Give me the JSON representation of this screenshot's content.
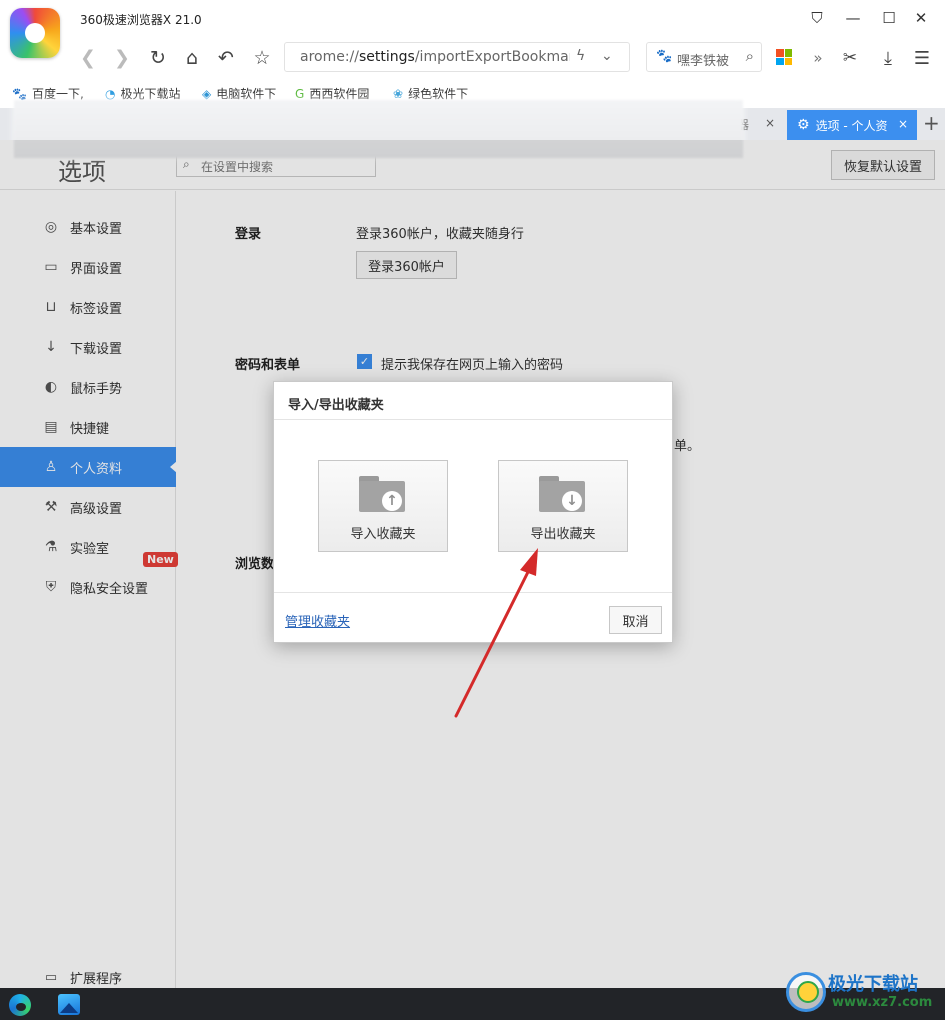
{
  "app": {
    "title": "360极速浏览器X 21.0",
    "icons": [
      "app-logo",
      "pin-icon",
      "minimize-icon",
      "maximize-icon",
      "close-icon"
    ]
  },
  "toolbar": {
    "url_prefix": "arome://",
    "url_host": "settings",
    "url_path": "/importExportBookmark",
    "search_text": "嘿李铁被",
    "icons": [
      "back-icon",
      "forward-icon",
      "reload-icon",
      "home-icon",
      "undo-icon",
      "star-icon",
      "bolt-icon",
      "chevron-down-icon",
      "paw-icon",
      "search-icon",
      "apps-icon",
      "more-icon",
      "scissors-icon",
      "download-icon",
      "menu-icon"
    ]
  },
  "bookmarks": [
    {
      "label": "百度一下,",
      "icon": "paw-icon"
    },
    {
      "label": "极光下载站",
      "icon": "aurora-icon"
    },
    {
      "label": "电脑软件下",
      "icon": "pc-icon"
    },
    {
      "label": "西西软件园",
      "icon": "cc-icon"
    },
    {
      "label": "绿色软件下",
      "icon": "leaf-icon"
    }
  ],
  "tabs": {
    "partial_label": "器",
    "active_label": "选项 - 个人资",
    "close_symbol": "×",
    "new_tab_symbol": "+"
  },
  "settings": {
    "title": "选项",
    "search_placeholder": "在设置中搜索",
    "reset_label": "恢复默认设置",
    "nav": [
      {
        "label": "基本设置",
        "icon": "settings-icon",
        "active": false
      },
      {
        "label": "界面设置",
        "icon": "window-icon",
        "active": false
      },
      {
        "label": "标签设置",
        "icon": "tab-icon",
        "active": false
      },
      {
        "label": "下载设置",
        "icon": "download-icon",
        "active": false
      },
      {
        "label": "鼠标手势",
        "icon": "mouse-icon",
        "active": false
      },
      {
        "label": "快捷键",
        "icon": "keyboard-icon",
        "active": false
      },
      {
        "label": "个人资料",
        "icon": "user-icon",
        "active": true
      },
      {
        "label": "高级设置",
        "icon": "wrench-icon",
        "active": false
      },
      {
        "label": "实验室",
        "icon": "flask-icon",
        "active": false
      },
      {
        "label": "隐私安全设置",
        "icon": "shield-icon",
        "active": false
      }
    ],
    "new_badge": "New",
    "extensions_label": "扩展程序",
    "login_section": "登录",
    "login_desc": "登录360帐户，收藏夹随身行",
    "login_button": "登录360帐户",
    "password_section": "密码和表单",
    "password_checkbox": "提示我保存在网页上输入的密码",
    "password_checked": true,
    "browse_section_partial": "浏览数",
    "partial_text": "单。"
  },
  "dialog": {
    "title": "导入/导出收藏夹",
    "import_label": "导入收藏夹",
    "export_label": "导出收藏夹",
    "manage_link": "管理收藏夹",
    "cancel_label": "取消"
  },
  "annotation": {
    "color": "#d42a2a"
  },
  "colors": {
    "accent": "#3c8fef",
    "new_badge": "#e8403a",
    "link": "#2a64b8"
  },
  "watermark": {
    "text": "极光下载站",
    "url": "www.xz7.com"
  }
}
